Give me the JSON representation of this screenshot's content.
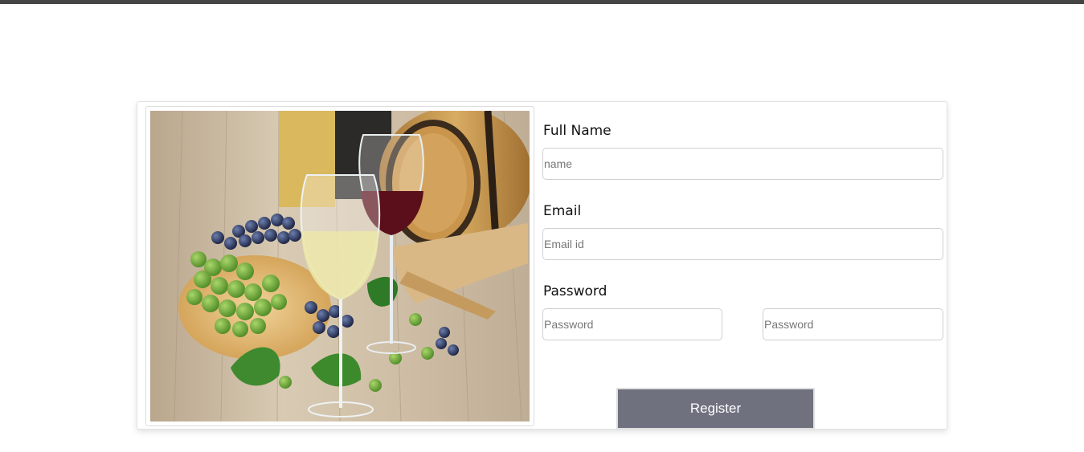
{
  "form": {
    "full_name": {
      "label": "Full Name",
      "placeholder": "name"
    },
    "email": {
      "label": "Email",
      "placeholder": "Email id"
    },
    "password": {
      "label": "Password",
      "placeholder": "Password",
      "confirm_placeholder": "Password"
    },
    "register_label": "Register"
  },
  "colors": {
    "top_bar": "#444444",
    "button": "#6f717f",
    "card_border": "#e2e2e2"
  }
}
